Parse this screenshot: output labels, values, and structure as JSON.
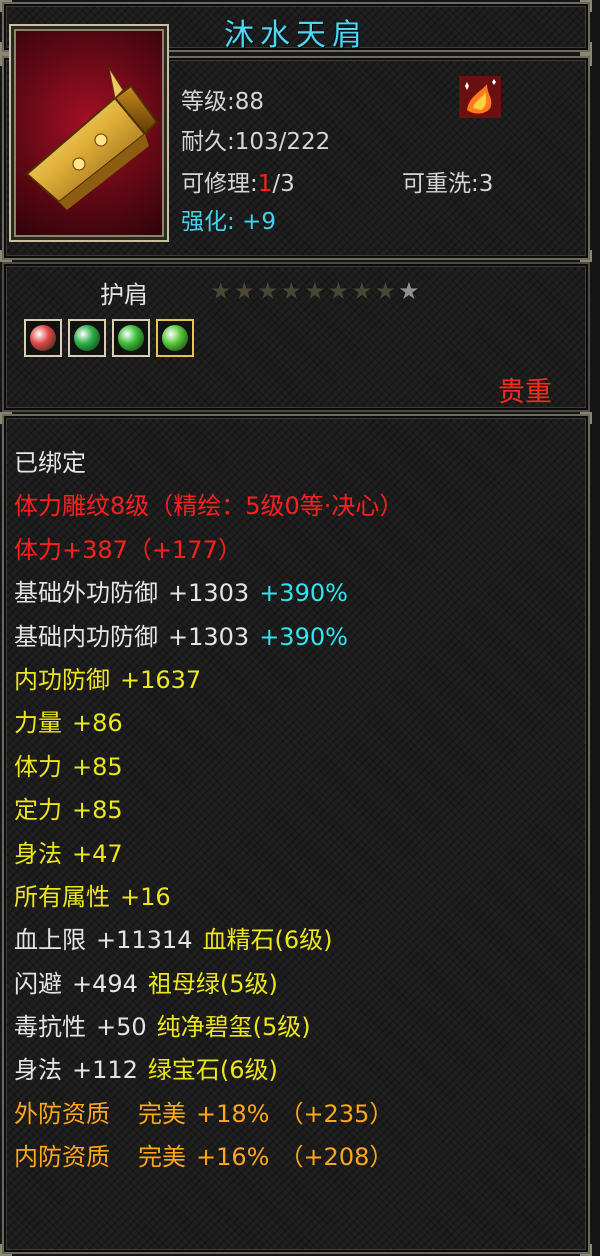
{
  "title": "沐水天肩",
  "item": {
    "level_label": "等级",
    "level": "88",
    "durability_label": "耐久",
    "durability": "103/222",
    "repair_label": "可修理",
    "repair_used": "1",
    "repair_max": "3",
    "rewash_label": "可重洗",
    "rewash": "3",
    "enhance_label": "强化",
    "enhance": "+9",
    "icon": "golden-shoulder-armor",
    "badge_icon": "fire-phoenix-icon"
  },
  "slot_type": "护肩",
  "stars": {
    "filled": 8,
    "total": 9
  },
  "gems": [
    {
      "icon": "red-gem-icon",
      "color": "#e04848"
    },
    {
      "icon": "emerald-gem-icon",
      "color": "#2fb04a"
    },
    {
      "icon": "emerald-gem-icon",
      "color": "#3fbf3a"
    },
    {
      "icon": "green-gem-icon",
      "color": "#58c83a"
    }
  ],
  "rarity": "贵重",
  "bound": "已绑定",
  "engraving": "体力雕纹8级（精绘：5级0等·决心）",
  "stamina_total": "体力+387（+177）",
  "base_ext_def": {
    "label": "基础外功防御",
    "value": "+1303",
    "bonus": "+390%"
  },
  "base_int_def": {
    "label": "基础内功防御",
    "value": "+1303",
    "bonus": "+390%"
  },
  "attributes": [
    {
      "label": "内功防御",
      "value": "+1637"
    },
    {
      "label": "力量",
      "value": "+86"
    },
    {
      "label": "体力",
      "value": "+85"
    },
    {
      "label": "定力",
      "value": "+85"
    },
    {
      "label": "身法",
      "value": "+47"
    },
    {
      "label": "所有属性",
      "value": "+16"
    }
  ],
  "gem_stats": [
    {
      "label": "血上限",
      "value": "+11314",
      "gem": "血精石(6级)"
    },
    {
      "label": "闪避",
      "value": "+494",
      "gem": "祖母绿(5级)"
    },
    {
      "label": "毒抗性",
      "value": "+50",
      "gem": "纯净碧玺(5级)"
    },
    {
      "label": "身法",
      "value": "+112",
      "gem": "绿宝石(6级)"
    }
  ],
  "qualities": [
    {
      "label": "外防资质",
      "grade": "完美",
      "pct": "+18%",
      "extra": "（+235）"
    },
    {
      "label": "内防资质",
      "grade": "完美",
      "pct": "+16%",
      "extra": "（+208）"
    }
  ],
  "colors": {
    "title": "#4fd6f2",
    "red": "#ff1f1f",
    "cyan": "#2fe6ee",
    "yellow": "#ece61d",
    "orange": "#ffa61a"
  }
}
